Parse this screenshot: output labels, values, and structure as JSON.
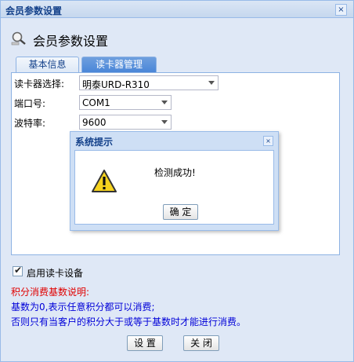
{
  "window": {
    "title": "会员参数设置",
    "close_glyph": "×"
  },
  "header": {
    "title": "会员参数设置",
    "icon": "search-settings-icon"
  },
  "tabs": [
    {
      "label": "基本信息",
      "active": false
    },
    {
      "label": "读卡器管理",
      "active": true
    }
  ],
  "form": {
    "reader_label": "读卡器选择:",
    "reader_value": "明泰URD-R310",
    "port_label": "端口号:",
    "port_value": "COM1",
    "baud_label": "波特率:",
    "baud_value": "9600"
  },
  "dialog": {
    "title": "系统提示",
    "close_glyph": "×",
    "message": "检测成功!",
    "ok_label": "确 定",
    "icon": "warning-icon"
  },
  "enable_reader": {
    "label": "启用读卡设备",
    "checked": true
  },
  "notes": {
    "title": "积分消费基数说明:",
    "line1": "基数为0,表示任意积分都可以消费;",
    "line2": "否则只有当客户的积分大于或等于基数时才能进行消费。"
  },
  "buttons": {
    "setup": "设 置",
    "close": "关 闭"
  },
  "colors": {
    "title_text": "#15428b",
    "note_title": "#e00000",
    "note_text": "#0000d8",
    "active_tab": "#4a86d8"
  }
}
